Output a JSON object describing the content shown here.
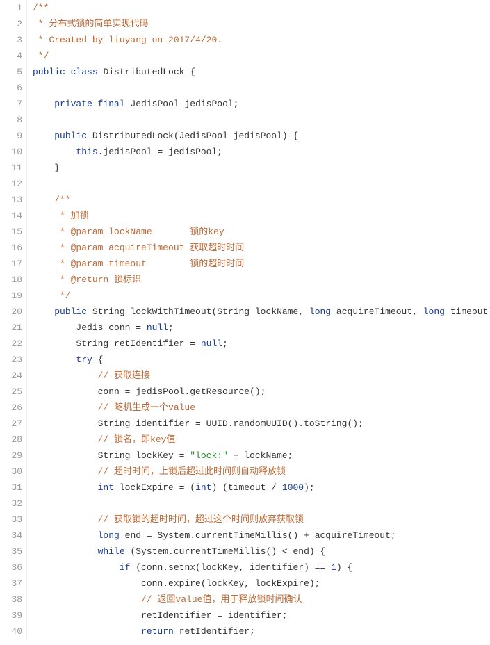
{
  "lineCount": 40,
  "lines": [
    [
      {
        "t": "/**",
        "c": "c-comment"
      }
    ],
    [
      {
        "t": " * 分布式锁的简单实现代码",
        "c": "c-comment"
      }
    ],
    [
      {
        "t": " * Created by liuyang on 2017/4/20.",
        "c": "c-comment"
      }
    ],
    [
      {
        "t": " */",
        "c": "c-comment"
      }
    ],
    [
      {
        "t": "public",
        "c": "c-kw"
      },
      {
        "t": " ",
        "c": "plain"
      },
      {
        "t": "class",
        "c": "c-kw"
      },
      {
        "t": " DistributedLock {",
        "c": "plain"
      }
    ],
    [
      {
        "t": "",
        "c": "plain"
      }
    ],
    [
      {
        "t": "    ",
        "c": "plain"
      },
      {
        "t": "private",
        "c": "c-kw"
      },
      {
        "t": " ",
        "c": "plain"
      },
      {
        "t": "final",
        "c": "c-kw"
      },
      {
        "t": " JedisPool jedisPool;",
        "c": "plain"
      }
    ],
    [
      {
        "t": "",
        "c": "plain"
      }
    ],
    [
      {
        "t": "    ",
        "c": "plain"
      },
      {
        "t": "public",
        "c": "c-kw"
      },
      {
        "t": " DistributedLock(JedisPool jedisPool) {",
        "c": "plain"
      }
    ],
    [
      {
        "t": "        ",
        "c": "plain"
      },
      {
        "t": "this",
        "c": "c-kw"
      },
      {
        "t": ".jedisPool = jedisPool;",
        "c": "plain"
      }
    ],
    [
      {
        "t": "    }",
        "c": "plain"
      }
    ],
    [
      {
        "t": "",
        "c": "plain"
      }
    ],
    [
      {
        "t": "    /**",
        "c": "c-comment"
      }
    ],
    [
      {
        "t": "     * 加锁",
        "c": "c-comment"
      }
    ],
    [
      {
        "t": "     * @param lockName       锁的key",
        "c": "c-comment"
      }
    ],
    [
      {
        "t": "     * @param acquireTimeout 获取超时时间",
        "c": "c-comment"
      }
    ],
    [
      {
        "t": "     * @param timeout        锁的超时时间",
        "c": "c-comment"
      }
    ],
    [
      {
        "t": "     * @return 锁标识",
        "c": "c-comment"
      }
    ],
    [
      {
        "t": "     */",
        "c": "c-comment"
      }
    ],
    [
      {
        "t": "    ",
        "c": "plain"
      },
      {
        "t": "public",
        "c": "c-kw"
      },
      {
        "t": " String lockWithTimeout(String lockName, ",
        "c": "plain"
      },
      {
        "t": "long",
        "c": "c-kw"
      },
      {
        "t": " acquireTimeout, ",
        "c": "plain"
      },
      {
        "t": "long",
        "c": "c-kw"
      },
      {
        "t": " timeout) {",
        "c": "plain"
      }
    ],
    [
      {
        "t": "        Jedis conn = ",
        "c": "plain"
      },
      {
        "t": "null",
        "c": "c-kw"
      },
      {
        "t": ";",
        "c": "plain"
      }
    ],
    [
      {
        "t": "        String retIdentifier = ",
        "c": "plain"
      },
      {
        "t": "null",
        "c": "c-kw"
      },
      {
        "t": ";",
        "c": "plain"
      }
    ],
    [
      {
        "t": "        ",
        "c": "plain"
      },
      {
        "t": "try",
        "c": "c-kw"
      },
      {
        "t": " {",
        "c": "plain"
      }
    ],
    [
      {
        "t": "            ",
        "c": "plain"
      },
      {
        "t": "// 获取连接",
        "c": "c-comment"
      }
    ],
    [
      {
        "t": "            conn = jedisPool.getResource();",
        "c": "plain"
      }
    ],
    [
      {
        "t": "            ",
        "c": "plain"
      },
      {
        "t": "// 随机生成一个value",
        "c": "c-comment"
      }
    ],
    [
      {
        "t": "            String identifier = UUID.randomUUID().toString();",
        "c": "plain"
      }
    ],
    [
      {
        "t": "            ",
        "c": "plain"
      },
      {
        "t": "// 锁名，即key值",
        "c": "c-comment"
      }
    ],
    [
      {
        "t": "            String lockKey = ",
        "c": "plain"
      },
      {
        "t": "\"lock:\"",
        "c": "c-str"
      },
      {
        "t": " + lockName;",
        "c": "plain"
      }
    ],
    [
      {
        "t": "            ",
        "c": "plain"
      },
      {
        "t": "// 超时时间，上锁后超过此时间则自动释放锁",
        "c": "c-comment"
      }
    ],
    [
      {
        "t": "            ",
        "c": "plain"
      },
      {
        "t": "int",
        "c": "c-kw"
      },
      {
        "t": " lockExpire = (",
        "c": "plain"
      },
      {
        "t": "int",
        "c": "c-kw"
      },
      {
        "t": ") (timeout / ",
        "c": "plain"
      },
      {
        "t": "1000",
        "c": "c-kw"
      },
      {
        "t": ");",
        "c": "plain"
      }
    ],
    [
      {
        "t": "",
        "c": "plain"
      }
    ],
    [
      {
        "t": "            ",
        "c": "plain"
      },
      {
        "t": "// 获取锁的超时时间，超过这个时间则放弃获取锁",
        "c": "c-comment"
      }
    ],
    [
      {
        "t": "            ",
        "c": "plain"
      },
      {
        "t": "long",
        "c": "c-kw"
      },
      {
        "t": " end = System.currentTimeMillis() + acquireTimeout;",
        "c": "plain"
      }
    ],
    [
      {
        "t": "            ",
        "c": "plain"
      },
      {
        "t": "while",
        "c": "c-kw"
      },
      {
        "t": " (System.currentTimeMillis() < end) {",
        "c": "plain"
      }
    ],
    [
      {
        "t": "                ",
        "c": "plain"
      },
      {
        "t": "if",
        "c": "c-kw"
      },
      {
        "t": " (conn.setnx(lockKey, identifier) == ",
        "c": "plain"
      },
      {
        "t": "1",
        "c": "c-kw"
      },
      {
        "t": ") {",
        "c": "plain"
      }
    ],
    [
      {
        "t": "                    conn.expire(lockKey, lockExpire);",
        "c": "plain"
      }
    ],
    [
      {
        "t": "                    ",
        "c": "plain"
      },
      {
        "t": "// 返回value值，用于释放锁时间确认",
        "c": "c-comment"
      }
    ],
    [
      {
        "t": "                    retIdentifier = identifier;",
        "c": "plain"
      }
    ],
    [
      {
        "t": "                    ",
        "c": "plain"
      },
      {
        "t": "return",
        "c": "c-kw"
      },
      {
        "t": " retIdentifier;",
        "c": "plain"
      }
    ]
  ]
}
